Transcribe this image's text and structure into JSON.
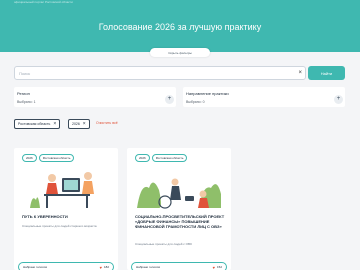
{
  "hero": {
    "top_text": "официальный портал Ростовской области",
    "title": "Голосование 2026 за лучшую практику",
    "collapse_label": "Скрыть фильтры"
  },
  "search": {
    "placeholder": "Поиск",
    "value": "",
    "clear_icon": "close-icon",
    "button_label": "Найти"
  },
  "filters": [
    {
      "label": "Регион",
      "value": "Выбрано: 1"
    },
    {
      "label": "Направление практики",
      "value": "Выбрано: 0"
    }
  ],
  "active_filters": {
    "chips": [
      {
        "label": "Ростовская область"
      },
      {
        "label": "2026"
      }
    ],
    "clear_all": "Очистить всё"
  },
  "cards": [
    {
      "tags": [
        "2026",
        "Ростовская область"
      ],
      "title": "ПУТЬ К УВЕРЕННОСТИ",
      "description": "Специальные проекты для людей старшего возраста",
      "vote_label": "Набрано голосов",
      "votes": "182"
    },
    {
      "tags": [
        "2026",
        "Ростовская область"
      ],
      "title": "СОЦИАЛЬНО-ПРОСВЕТИТЕЛЬСКИЙ ПРОЕКТ «ДОБРЫЕ ФИНАНСЫ» ПОВЫШЕНИЕ ФИНАНСОВОЙ ГРАМОТНОСТИ ЛИЦ С ОВЗ»",
      "description": "Специальные проекты для людей с ОВЗ",
      "vote_label": "Набрано голосов",
      "votes": "152"
    }
  ],
  "colors": {
    "accent": "#3fb8b0",
    "danger": "#e0533a",
    "text": "#1c2a3a",
    "background": "#f4f5f7"
  }
}
